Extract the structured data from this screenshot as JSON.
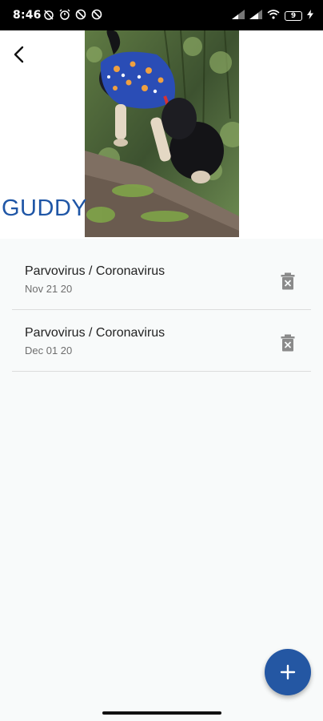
{
  "status_bar": {
    "time": "8:46",
    "battery_level": "9",
    "left_icons": [
      "alarm-off-icon",
      "alarm-icon",
      "blocked-icon",
      "blocked-icon"
    ],
    "right_icons": [
      "signal-icon",
      "signal-icon",
      "wifi-icon",
      "battery-icon",
      "charging-icon"
    ]
  },
  "header": {
    "back_icon": "chevron-left-icon",
    "pet_name": "GUDDY",
    "pet_photo": "dog-photo",
    "name_color": "#1f56a6"
  },
  "records": [
    {
      "title": "Parvovirus / Coronavirus",
      "date": "Nov 21 20",
      "action_icon": "delete-icon"
    },
    {
      "title": "Parvovirus / Coronavirus",
      "date": "Dec 01 20",
      "action_icon": "delete-icon"
    }
  ],
  "fab": {
    "icon": "plus-icon",
    "color": "#2457a3"
  }
}
